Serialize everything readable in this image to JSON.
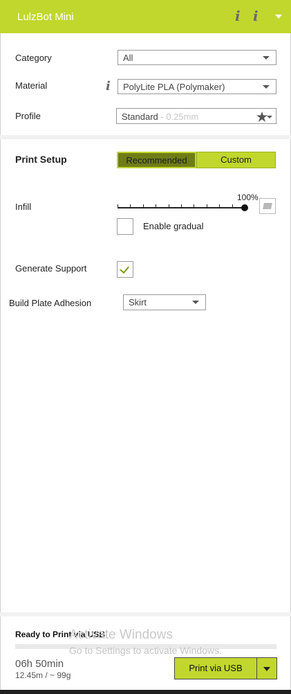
{
  "header": {
    "title": "LulzBot Mini",
    "info_icons": [
      "i",
      "i"
    ]
  },
  "material_info_icon": "i",
  "fields": {
    "category": {
      "label": "Category",
      "value": "All"
    },
    "material": {
      "label": "Material",
      "value": "PolyLite PLA (Polymaker)"
    },
    "profile": {
      "label": "Profile",
      "value": "Standard",
      "detail": " - 0.25mm"
    }
  },
  "print_setup": {
    "title": "Print Setup",
    "recommended_label": "Recommended",
    "custom_label": "Custom",
    "active": "recommended"
  },
  "infill": {
    "label": "Infill",
    "value": "100%",
    "fraction": 1.0,
    "ticks": 10
  },
  "gradual": {
    "label": "Enable gradual",
    "checked": false
  },
  "support": {
    "label": "Generate Support",
    "checked": true
  },
  "adhesion": {
    "label": "Build Plate Adhesion",
    "value": "Skirt"
  },
  "status": {
    "ready": "Ready to Print via USB",
    "time": "06h 50min",
    "usage": "12.45m / ~ 99g",
    "print_button": "Print via USB"
  },
  "watermark": {
    "line1": "Activate Windows",
    "line2": "Go to Settings to activate Windows."
  },
  "colors": {
    "accent": "#c1d72e",
    "accent_dark": "#6f7d16"
  },
  "icons": [
    "info-icon",
    "chevron-down-icon",
    "star-icon",
    "checkmark-icon",
    "solid-cube-icon"
  ]
}
